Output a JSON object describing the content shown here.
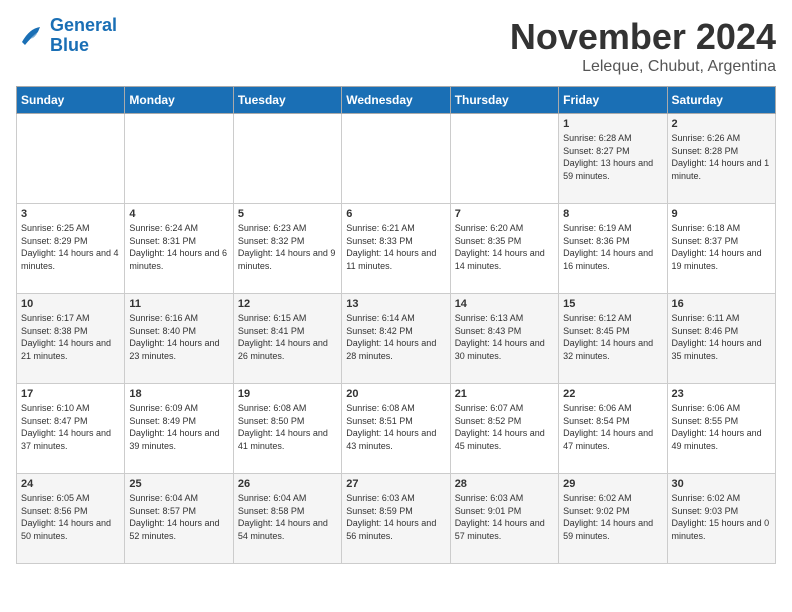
{
  "logo": {
    "line1": "General",
    "line2": "Blue"
  },
  "title": "November 2024",
  "subtitle": "Leleque, Chubut, Argentina",
  "days_header": [
    "Sunday",
    "Monday",
    "Tuesday",
    "Wednesday",
    "Thursday",
    "Friday",
    "Saturday"
  ],
  "weeks": [
    [
      {
        "day": "",
        "sunrise": "",
        "sunset": "",
        "daylight": ""
      },
      {
        "day": "",
        "sunrise": "",
        "sunset": "",
        "daylight": ""
      },
      {
        "day": "",
        "sunrise": "",
        "sunset": "",
        "daylight": ""
      },
      {
        "day": "",
        "sunrise": "",
        "sunset": "",
        "daylight": ""
      },
      {
        "day": "",
        "sunrise": "",
        "sunset": "",
        "daylight": ""
      },
      {
        "day": "1",
        "sunrise": "Sunrise: 6:28 AM",
        "sunset": "Sunset: 8:27 PM",
        "daylight": "Daylight: 13 hours and 59 minutes."
      },
      {
        "day": "2",
        "sunrise": "Sunrise: 6:26 AM",
        "sunset": "Sunset: 8:28 PM",
        "daylight": "Daylight: 14 hours and 1 minute."
      }
    ],
    [
      {
        "day": "3",
        "sunrise": "Sunrise: 6:25 AM",
        "sunset": "Sunset: 8:29 PM",
        "daylight": "Daylight: 14 hours and 4 minutes."
      },
      {
        "day": "4",
        "sunrise": "Sunrise: 6:24 AM",
        "sunset": "Sunset: 8:31 PM",
        "daylight": "Daylight: 14 hours and 6 minutes."
      },
      {
        "day": "5",
        "sunrise": "Sunrise: 6:23 AM",
        "sunset": "Sunset: 8:32 PM",
        "daylight": "Daylight: 14 hours and 9 minutes."
      },
      {
        "day": "6",
        "sunrise": "Sunrise: 6:21 AM",
        "sunset": "Sunset: 8:33 PM",
        "daylight": "Daylight: 14 hours and 11 minutes."
      },
      {
        "day": "7",
        "sunrise": "Sunrise: 6:20 AM",
        "sunset": "Sunset: 8:35 PM",
        "daylight": "Daylight: 14 hours and 14 minutes."
      },
      {
        "day": "8",
        "sunrise": "Sunrise: 6:19 AM",
        "sunset": "Sunset: 8:36 PM",
        "daylight": "Daylight: 14 hours and 16 minutes."
      },
      {
        "day": "9",
        "sunrise": "Sunrise: 6:18 AM",
        "sunset": "Sunset: 8:37 PM",
        "daylight": "Daylight: 14 hours and 19 minutes."
      }
    ],
    [
      {
        "day": "10",
        "sunrise": "Sunrise: 6:17 AM",
        "sunset": "Sunset: 8:38 PM",
        "daylight": "Daylight: 14 hours and 21 minutes."
      },
      {
        "day": "11",
        "sunrise": "Sunrise: 6:16 AM",
        "sunset": "Sunset: 8:40 PM",
        "daylight": "Daylight: 14 hours and 23 minutes."
      },
      {
        "day": "12",
        "sunrise": "Sunrise: 6:15 AM",
        "sunset": "Sunset: 8:41 PM",
        "daylight": "Daylight: 14 hours and 26 minutes."
      },
      {
        "day": "13",
        "sunrise": "Sunrise: 6:14 AM",
        "sunset": "Sunset: 8:42 PM",
        "daylight": "Daylight: 14 hours and 28 minutes."
      },
      {
        "day": "14",
        "sunrise": "Sunrise: 6:13 AM",
        "sunset": "Sunset: 8:43 PM",
        "daylight": "Daylight: 14 hours and 30 minutes."
      },
      {
        "day": "15",
        "sunrise": "Sunrise: 6:12 AM",
        "sunset": "Sunset: 8:45 PM",
        "daylight": "Daylight: 14 hours and 32 minutes."
      },
      {
        "day": "16",
        "sunrise": "Sunrise: 6:11 AM",
        "sunset": "Sunset: 8:46 PM",
        "daylight": "Daylight: 14 hours and 35 minutes."
      }
    ],
    [
      {
        "day": "17",
        "sunrise": "Sunrise: 6:10 AM",
        "sunset": "Sunset: 8:47 PM",
        "daylight": "Daylight: 14 hours and 37 minutes."
      },
      {
        "day": "18",
        "sunrise": "Sunrise: 6:09 AM",
        "sunset": "Sunset: 8:49 PM",
        "daylight": "Daylight: 14 hours and 39 minutes."
      },
      {
        "day": "19",
        "sunrise": "Sunrise: 6:08 AM",
        "sunset": "Sunset: 8:50 PM",
        "daylight": "Daylight: 14 hours and 41 minutes."
      },
      {
        "day": "20",
        "sunrise": "Sunrise: 6:08 AM",
        "sunset": "Sunset: 8:51 PM",
        "daylight": "Daylight: 14 hours and 43 minutes."
      },
      {
        "day": "21",
        "sunrise": "Sunrise: 6:07 AM",
        "sunset": "Sunset: 8:52 PM",
        "daylight": "Daylight: 14 hours and 45 minutes."
      },
      {
        "day": "22",
        "sunrise": "Sunrise: 6:06 AM",
        "sunset": "Sunset: 8:54 PM",
        "daylight": "Daylight: 14 hours and 47 minutes."
      },
      {
        "day": "23",
        "sunrise": "Sunrise: 6:06 AM",
        "sunset": "Sunset: 8:55 PM",
        "daylight": "Daylight: 14 hours and 49 minutes."
      }
    ],
    [
      {
        "day": "24",
        "sunrise": "Sunrise: 6:05 AM",
        "sunset": "Sunset: 8:56 PM",
        "daylight": "Daylight: 14 hours and 50 minutes."
      },
      {
        "day": "25",
        "sunrise": "Sunrise: 6:04 AM",
        "sunset": "Sunset: 8:57 PM",
        "daylight": "Daylight: 14 hours and 52 minutes."
      },
      {
        "day": "26",
        "sunrise": "Sunrise: 6:04 AM",
        "sunset": "Sunset: 8:58 PM",
        "daylight": "Daylight: 14 hours and 54 minutes."
      },
      {
        "day": "27",
        "sunrise": "Sunrise: 6:03 AM",
        "sunset": "Sunset: 8:59 PM",
        "daylight": "Daylight: 14 hours and 56 minutes."
      },
      {
        "day": "28",
        "sunrise": "Sunrise: 6:03 AM",
        "sunset": "Sunset: 9:01 PM",
        "daylight": "Daylight: 14 hours and 57 minutes."
      },
      {
        "day": "29",
        "sunrise": "Sunrise: 6:02 AM",
        "sunset": "Sunset: 9:02 PM",
        "daylight": "Daylight: 14 hours and 59 minutes."
      },
      {
        "day": "30",
        "sunrise": "Sunrise: 6:02 AM",
        "sunset": "Sunset: 9:03 PM",
        "daylight": "Daylight: 15 hours and 0 minutes."
      }
    ]
  ]
}
